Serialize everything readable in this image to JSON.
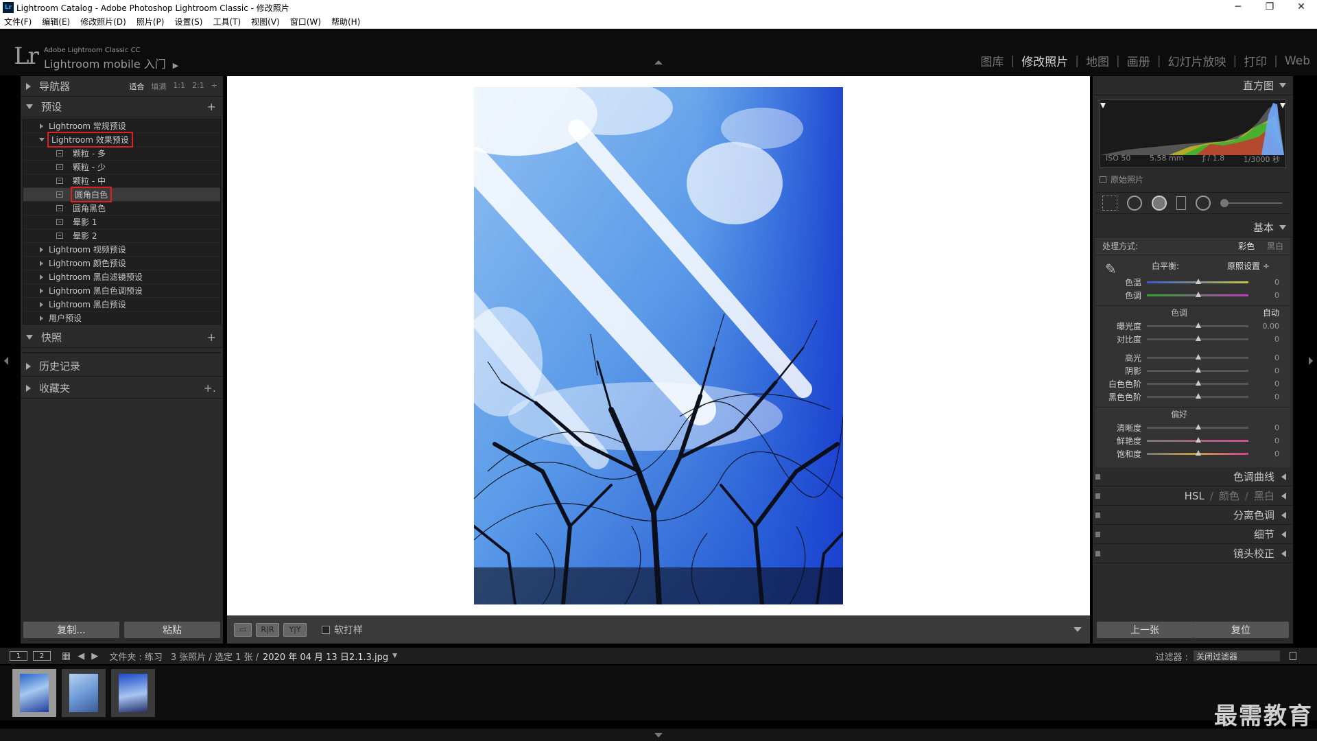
{
  "window": {
    "title": "Lightroom Catalog - Adobe Photoshop Lightroom Classic - 修改照片",
    "icon_text": "Lr",
    "controls": [
      "─",
      "❐",
      "✕"
    ]
  },
  "menubar": [
    "文件(F)",
    "编辑(E)",
    "修改照片(D)",
    "照片(P)",
    "设置(S)",
    "工具(T)",
    "视图(V)",
    "窗口(W)",
    "帮助(H)"
  ],
  "identity": {
    "logo": "Lr",
    "line1": "Adobe Lightroom Classic CC",
    "line2": "Lightroom mobile 入门",
    "arrow": "▶"
  },
  "modules": [
    "图库",
    "修改照片",
    "地图",
    "画册",
    "幻灯片放映",
    "打印",
    "Web"
  ],
  "module_active": "修改照片",
  "left": {
    "navigator": {
      "title": "导航器",
      "zoom": [
        "适合",
        "填满",
        "1:1",
        "2:1"
      ],
      "zoom_current": "适合",
      "zoom_arrow": "÷"
    },
    "presets": {
      "title": "预设",
      "add": "+",
      "items": [
        {
          "label": "Lightroom 常规预设",
          "kind": "folder"
        },
        {
          "label": "Lightroom 效果预设",
          "kind": "folder-open",
          "highlight": true
        },
        {
          "label": "颗粒 - 多",
          "kind": "preset"
        },
        {
          "label": "颗粒 - 少",
          "kind": "preset"
        },
        {
          "label": "颗粒 - 中",
          "kind": "preset"
        },
        {
          "label": "圆角白色",
          "kind": "preset",
          "highlight": true,
          "selected": true
        },
        {
          "label": "圆角黑色",
          "kind": "preset"
        },
        {
          "label": "晕影 1",
          "kind": "preset"
        },
        {
          "label": "晕影 2",
          "kind": "preset"
        },
        {
          "label": "Lightroom 视频预设",
          "kind": "folder"
        },
        {
          "label": "Lightroom 颜色预设",
          "kind": "folder"
        },
        {
          "label": "Lightroom 黑白滤镜预设",
          "kind": "folder"
        },
        {
          "label": "Lightroom 黑白色调预设",
          "kind": "folder"
        },
        {
          "label": "Lightroom 黑白预设",
          "kind": "folder"
        },
        {
          "label": "用户预设",
          "kind": "folder"
        }
      ]
    },
    "snapshots": {
      "title": "快照",
      "add": "+"
    },
    "history": {
      "title": "历史记录"
    },
    "collections": {
      "title": "收藏夹",
      "add": "+."
    },
    "copy_button": "复制...",
    "paste_button": "粘贴"
  },
  "toolbar": {
    "view_btn1": "▭",
    "view_btn2": "R|R",
    "view_btn3": "Y|Y",
    "softproof_label": "软打样"
  },
  "right": {
    "histogram": {
      "title": "直方图",
      "iso": "ISO 50",
      "focal": "5.58 mm",
      "aperture": "ƒ / 1.8",
      "shutter": "1/3000 秒"
    },
    "original_label": "原始照片",
    "basic": {
      "title": "基本",
      "treatment_label": "处理方式:",
      "treatment_options": [
        "彩色",
        "黑白"
      ],
      "treatment_selected": "彩色",
      "wb_label": "白平衡:",
      "wb_value": "原照设置 ÷",
      "wb_sliders": [
        {
          "label": "色温",
          "value": "0",
          "track": "temp"
        },
        {
          "label": "色调",
          "value": "0",
          "track": "tint"
        }
      ],
      "tone_title": "色调",
      "tone_auto": "自动",
      "tone_sliders": [
        {
          "label": "曝光度",
          "value": "0.00"
        },
        {
          "label": "对比度",
          "value": "0"
        }
      ],
      "tone_sliders2": [
        {
          "label": "高光",
          "value": "0"
        },
        {
          "label": "阴影",
          "value": "0"
        },
        {
          "label": "白色色阶",
          "value": "0"
        },
        {
          "label": "黑色色阶",
          "value": "0"
        }
      ],
      "presence_title": "偏好",
      "presence_sliders": [
        {
          "label": "清晰度",
          "value": "0",
          "track": ""
        },
        {
          "label": "鲜艳度",
          "value": "0",
          "track": "vib"
        },
        {
          "label": "饱和度",
          "value": "0",
          "track": "sat"
        }
      ]
    },
    "panels": [
      "色调曲线",
      "分离色调",
      "细节",
      "镜头校正"
    ],
    "hsl_panel": {
      "hsl": "HSL",
      "sep1": "/",
      "color": "颜色",
      "sep2": "/",
      "bw": "黑白"
    },
    "prev_button": "上一张",
    "reset_button": "复位"
  },
  "filmbar": {
    "num1": "1",
    "num2": "2",
    "folder": "文件夹 : 练习",
    "count": "3 张照片 / 选定 1 张 /",
    "filename": "2020 年 04 月 13 日2.1.3.jpg",
    "filter_label": "过滤器 :",
    "filter_value": "关闭过滤器"
  },
  "watermark": "最需教育",
  "colors": {
    "accent_highlight": "#e02020",
    "panel_bg": "#2b2b2b",
    "sky_top": "#6aa8ec",
    "sky_bottom": "#1b4fd1"
  }
}
